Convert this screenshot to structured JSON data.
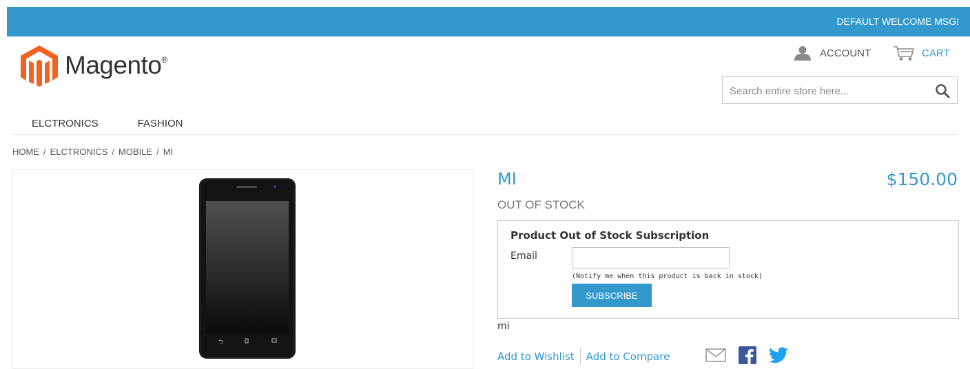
{
  "header": {
    "welcome": "DEFAULT WELCOME MSG!",
    "logo_text": "Magento",
    "logo_reg": "®",
    "account_label": "ACCOUNT",
    "cart_label": "CART",
    "search_placeholder": "Search entire store here..."
  },
  "nav": {
    "items": [
      "ELCTRONICS",
      "FASHION"
    ]
  },
  "breadcrumb": [
    "HOME",
    "ELCTRONICS",
    "MOBILE",
    "MI"
  ],
  "breadcrumb_separator": "/",
  "product": {
    "name": "MI",
    "price": "$150.00",
    "stock_status": "OUT OF STOCK",
    "short_description": "mi"
  },
  "subscription": {
    "title": "Product Out of Stock Subscription",
    "email_label": "Email",
    "email_value": "",
    "notify_text": "(Notify me when this product is back in stock)",
    "button_label": "SUBSCRIBE"
  },
  "actions": {
    "wishlist": "Add to Wishlist",
    "compare": "Add to Compare"
  },
  "colors": {
    "accent": "#3399cc",
    "logo_orange": "#f26322"
  }
}
